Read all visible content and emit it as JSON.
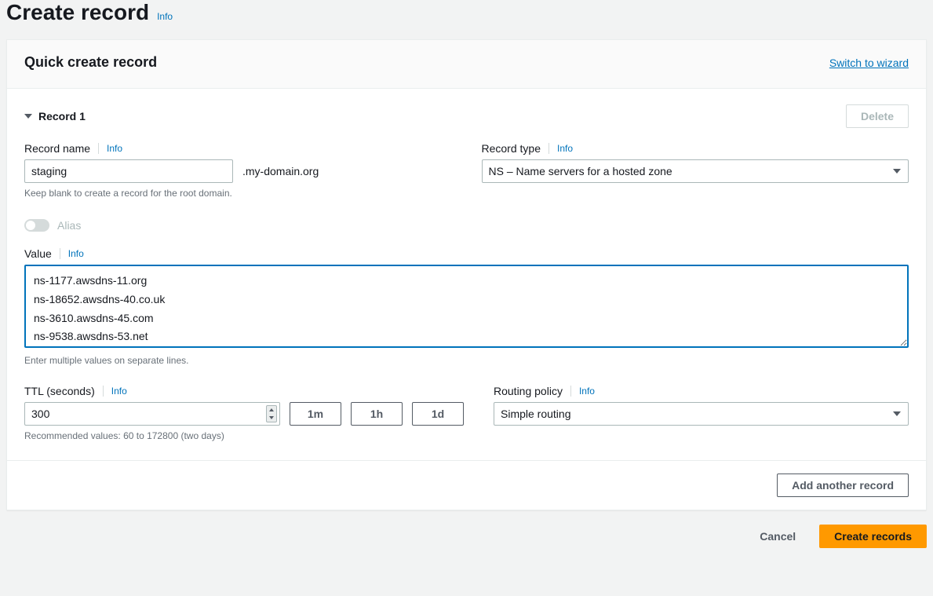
{
  "header": {
    "title": "Create record",
    "info": "Info"
  },
  "panel": {
    "title": "Quick create record",
    "switch_link": "Switch to wizard"
  },
  "record": {
    "header": "Record 1",
    "delete_label": "Delete",
    "name": {
      "label": "Record name",
      "info": "Info",
      "value": "staging",
      "suffix": ".my-domain.org",
      "help": "Keep blank to create a record for the root domain."
    },
    "type": {
      "label": "Record type",
      "info": "Info",
      "value": "NS – Name servers for a hosted zone"
    },
    "alias_label": "Alias",
    "value_field": {
      "label": "Value",
      "info": "Info",
      "value": "ns-1177.awsdns-11.org\nns-18652.awsdns-40.co.uk\nns-3610.awsdns-45.com\nns-9538.awsdns-53.net",
      "help": "Enter multiple values on separate lines."
    },
    "ttl": {
      "label": "TTL (seconds)",
      "info": "Info",
      "value": "300",
      "shortcut_1m": "1m",
      "shortcut_1h": "1h",
      "shortcut_1d": "1d",
      "help": "Recommended values: 60 to 172800 (two days)"
    },
    "routing": {
      "label": "Routing policy",
      "info": "Info",
      "value": "Simple routing"
    }
  },
  "footer": {
    "add_another": "Add another record",
    "cancel": "Cancel",
    "create": "Create records"
  }
}
